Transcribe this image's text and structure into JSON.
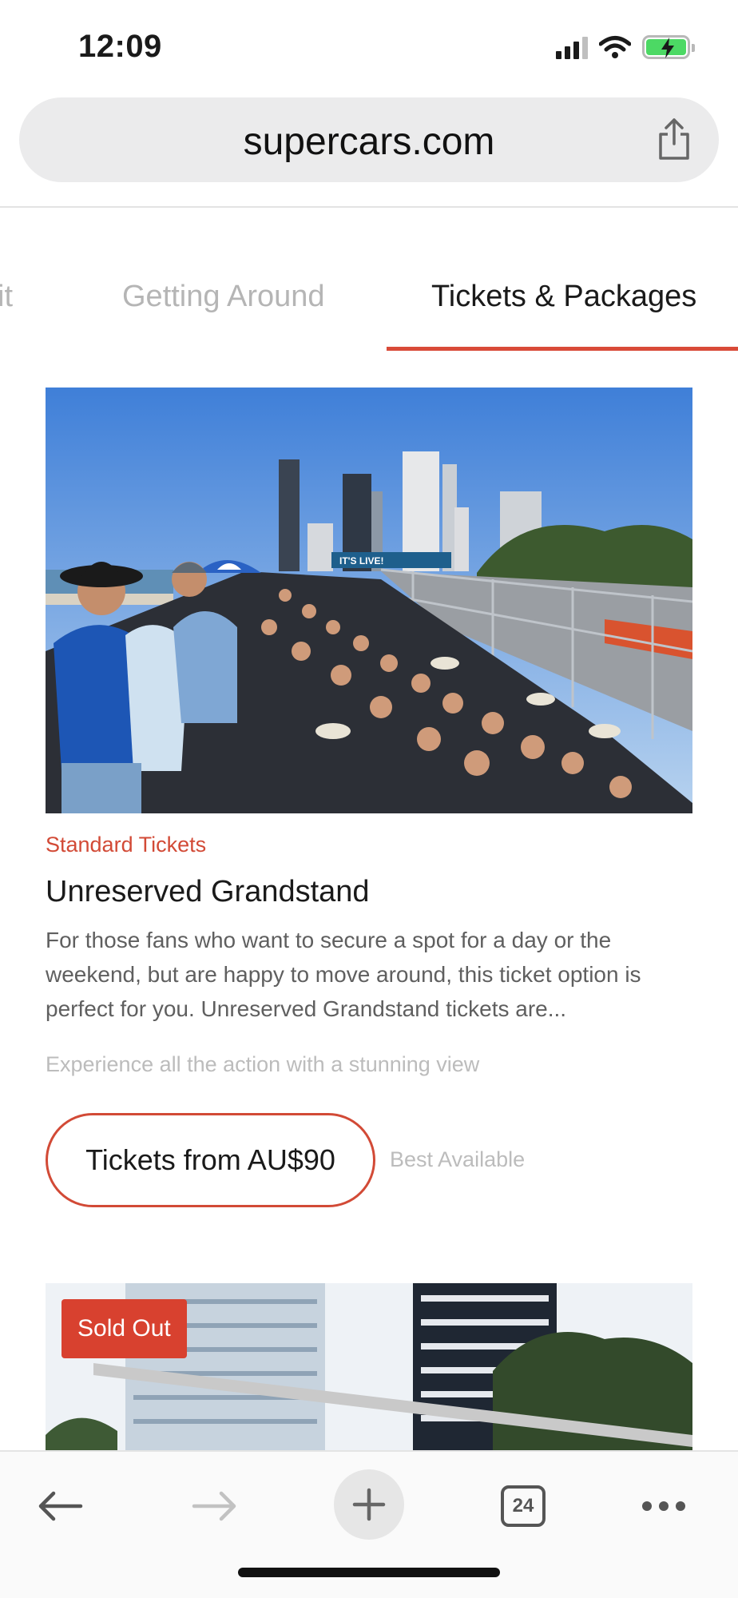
{
  "status_bar": {
    "time": "12:09"
  },
  "browser": {
    "url": "supercars.com",
    "tabs_count": "24"
  },
  "nav_tabs": [
    {
      "label": "sit"
    },
    {
      "label": "Getting Around"
    },
    {
      "label": "Tickets & Packages",
      "active": true
    }
  ],
  "cards": [
    {
      "category": "Standard Tickets",
      "title": "Unreserved Grandstand",
      "description": "For those fans who want to secure a spot for a day or the weekend, but are happy to move around, this ticket option is perfect for you. Unreserved Grandstand tickets are...",
      "subtitle": "Experience all the action with a stunning view",
      "button_label": "Tickets from AU$90",
      "availability": "Best Available",
      "banner_text": "IT'S LIVE!"
    },
    {
      "badge": "Sold Out"
    }
  ],
  "toolbar": {
    "back_icon": "arrow-left-icon",
    "forward_icon": "arrow-right-icon",
    "new_tab_icon": "plus-icon",
    "tabs_icon": "tabs-icon",
    "more_icon": "ellipsis-icon"
  },
  "colors": {
    "accent": "#d24a36",
    "sold_out": "#d8412f",
    "battery": "#4cd964"
  }
}
